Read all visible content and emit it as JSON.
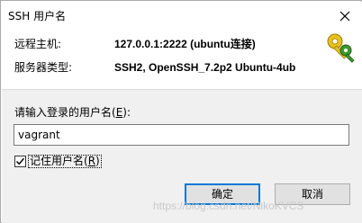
{
  "window": {
    "title": "SSH 用户名"
  },
  "info": {
    "host_label": "远程主机:",
    "host_value": "127.0.0.1:2222 (ubuntu连接)",
    "server_type_label": "服务器类型:",
    "server_type_value": "SSH2, OpenSSH_7.2p2 Ubuntu-4ub"
  },
  "form": {
    "prompt_prefix": "请输入登录的用户名(",
    "prompt_accel": "E",
    "prompt_suffix": "):",
    "username_value": "vagrant",
    "remember_prefix": "记住用户名(",
    "remember_accel": "R",
    "remember_suffix": ")",
    "remember_checked": true
  },
  "buttons": {
    "ok_label": "确定",
    "cancel_label": "取消"
  },
  "watermark": "https://blog.csdn.net/NikoKVCS",
  "icons": {
    "close": "close-icon",
    "keys": "keys-icon",
    "check": "check-icon"
  },
  "colors": {
    "accent": "#0078d7",
    "keys_yellow": "#e8c11a",
    "keys_green": "#3c9a2e"
  }
}
